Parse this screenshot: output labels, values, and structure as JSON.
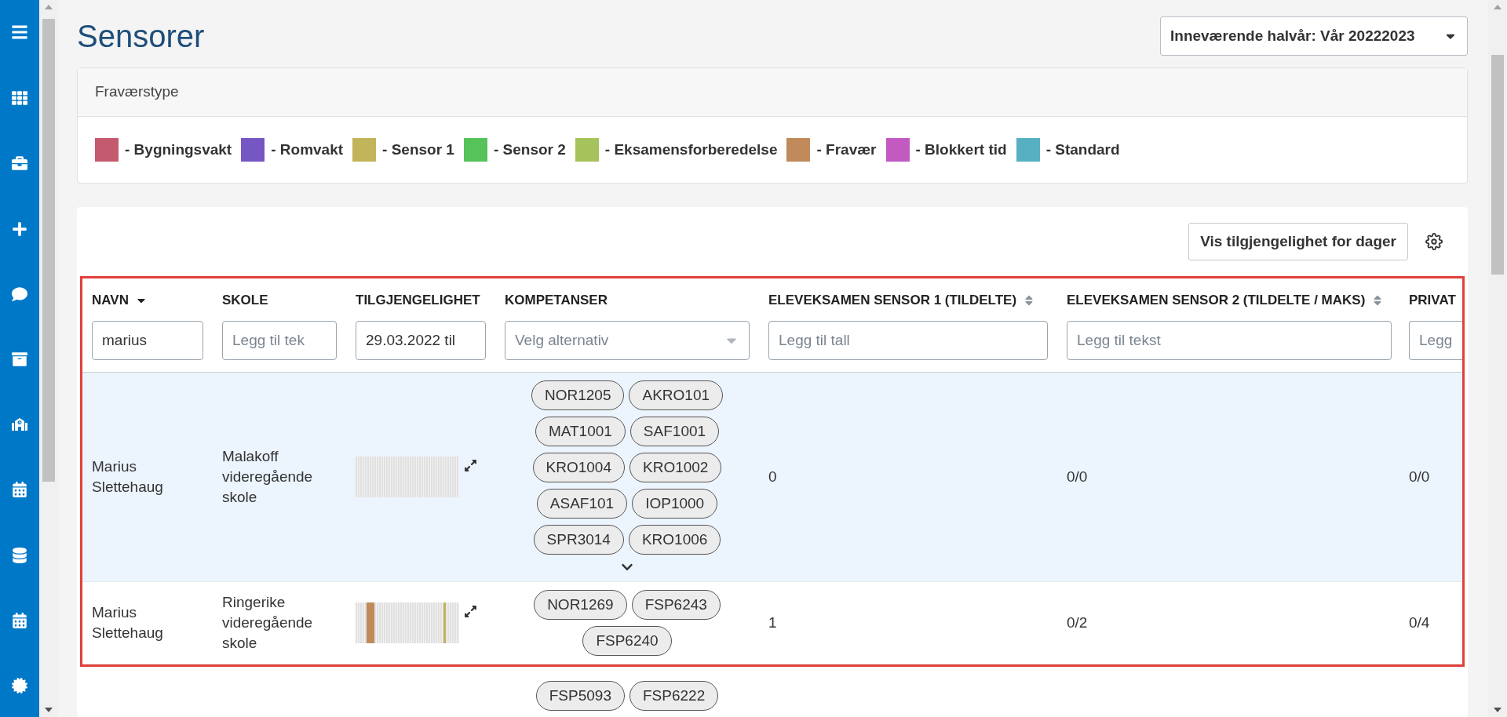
{
  "page": {
    "title": "Sensorer",
    "period_dropdown": "Inneværende halvår: Vår 20222023"
  },
  "legend": {
    "title": "Fraværstype",
    "items": [
      {
        "label": "- Bygningsvakt",
        "color": "#c45a6e"
      },
      {
        "label": "- Romvakt",
        "color": "#7656c2"
      },
      {
        "label": "- Sensor 1",
        "color": "#c2b45a"
      },
      {
        "label": "- Sensor 2",
        "color": "#56c25a"
      },
      {
        "label": "- Eksamensforberedelse",
        "color": "#a6c25a"
      },
      {
        "label": "- Fravær",
        "color": "#c08a5a"
      },
      {
        "label": "- Blokkert tid",
        "color": "#c25ac2"
      },
      {
        "label": "- Standard",
        "color": "#56b0c2"
      }
    ]
  },
  "toolbar": {
    "button": "Vis tilgjengelighet for dager"
  },
  "table": {
    "columns": [
      {
        "label": "NAVN",
        "sortable": false,
        "sorted": true,
        "filter": {
          "kind": "text",
          "value": "marius"
        }
      },
      {
        "label": "SKOLE",
        "sortable": false,
        "sorted": false,
        "filter": {
          "kind": "text",
          "placeholder": "Legg til tek"
        }
      },
      {
        "label": "TILGJENGELIGHET",
        "sortable": false,
        "sorted": false,
        "filter": {
          "kind": "text",
          "value": "29.03.2022 til"
        }
      },
      {
        "label": "KOMPETANSER",
        "sortable": false,
        "sorted": false,
        "filter": {
          "kind": "select",
          "placeholder": "Velg alternativ"
        }
      },
      {
        "label": "ELEVEKSAMEN SENSOR 1 (TILDELTE)",
        "sortable": true,
        "sorted": false,
        "filter": {
          "kind": "text",
          "placeholder": "Legg til tall"
        }
      },
      {
        "label": "ELEVEKSAMEN SENSOR 2 (TILDELTE / MAKS)",
        "sortable": true,
        "sorted": false,
        "filter": {
          "kind": "text",
          "placeholder": "Legg til tekst"
        }
      },
      {
        "label": "PRIVAT",
        "sortable": false,
        "sorted": false,
        "filter": {
          "kind": "text",
          "placeholder": "Legg"
        }
      }
    ],
    "rows": [
      {
        "selected": true,
        "name": "Marius Slettehaug",
        "school": "Malakoff videregående skole",
        "availability_marks": [],
        "competences": [
          "NOR1205",
          "AKRO101",
          "MAT1001",
          "SAF1001",
          "KRO1004",
          "KRO1002",
          "ASAF101",
          "IOP1000",
          "SPR3014",
          "KRO1006"
        ],
        "show_more": true,
        "sensor1": "0",
        "sensor2": "0/0",
        "privat": "0/0"
      },
      {
        "selected": false,
        "name": "Marius Slettehaug",
        "school": "Ringerike videregående skole",
        "availability_marks": [
          {
            "color": "#c08a5a"
          },
          {
            "color": "#c2b45a"
          }
        ],
        "competences": [
          "NOR1269",
          "FSP6243",
          "FSP6240"
        ],
        "show_more": false,
        "sensor1": "1",
        "sensor2": "0/2",
        "privat": "0/4"
      },
      {
        "selected": false,
        "competences": [
          "FSP5093",
          "FSP6222"
        ],
        "show_more": false
      }
    ]
  }
}
